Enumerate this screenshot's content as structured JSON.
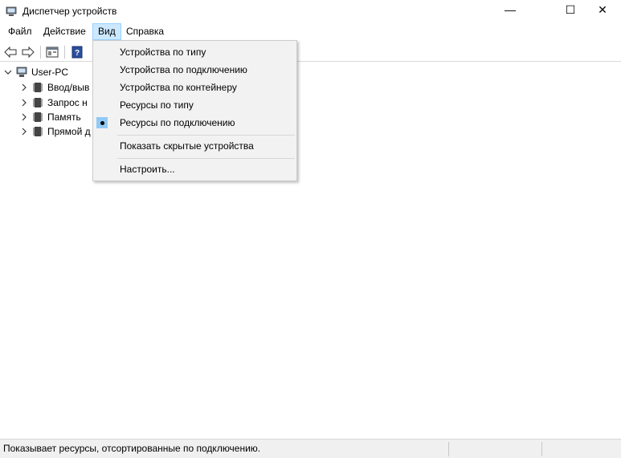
{
  "window": {
    "title": "Диспетчер устройств",
    "controls": {
      "minimize": "—",
      "maximize": "☐",
      "close": "✕"
    }
  },
  "menubar": {
    "items": [
      "Файл",
      "Действие",
      "Вид",
      "Справка"
    ],
    "active_item": "Вид"
  },
  "toolbar": {
    "buttons": [
      "back-arrow-icon",
      "forward-arrow-icon",
      "properties-icon",
      "help-icon"
    ]
  },
  "tree": {
    "root": "User-PC",
    "children": [
      "Ввод/выв",
      "Запрос н",
      "Память",
      "Прямой д"
    ]
  },
  "view_menu": {
    "items": [
      "Устройства по типу",
      "Устройства по подключению",
      "Устройства по контейнеру",
      "Ресурсы по типу",
      "Ресурсы по подключению",
      "Показать скрытые устройства",
      "Настроить..."
    ],
    "checked_item": "Ресурсы по подключению"
  },
  "statusbar": {
    "text": "Показывает ресурсы, отсортированные по подключению."
  },
  "colors": {
    "menu_highlight": "#cce8ff",
    "check_bg": "#91c9f7",
    "dropdown_bg": "#f2f2f2"
  }
}
